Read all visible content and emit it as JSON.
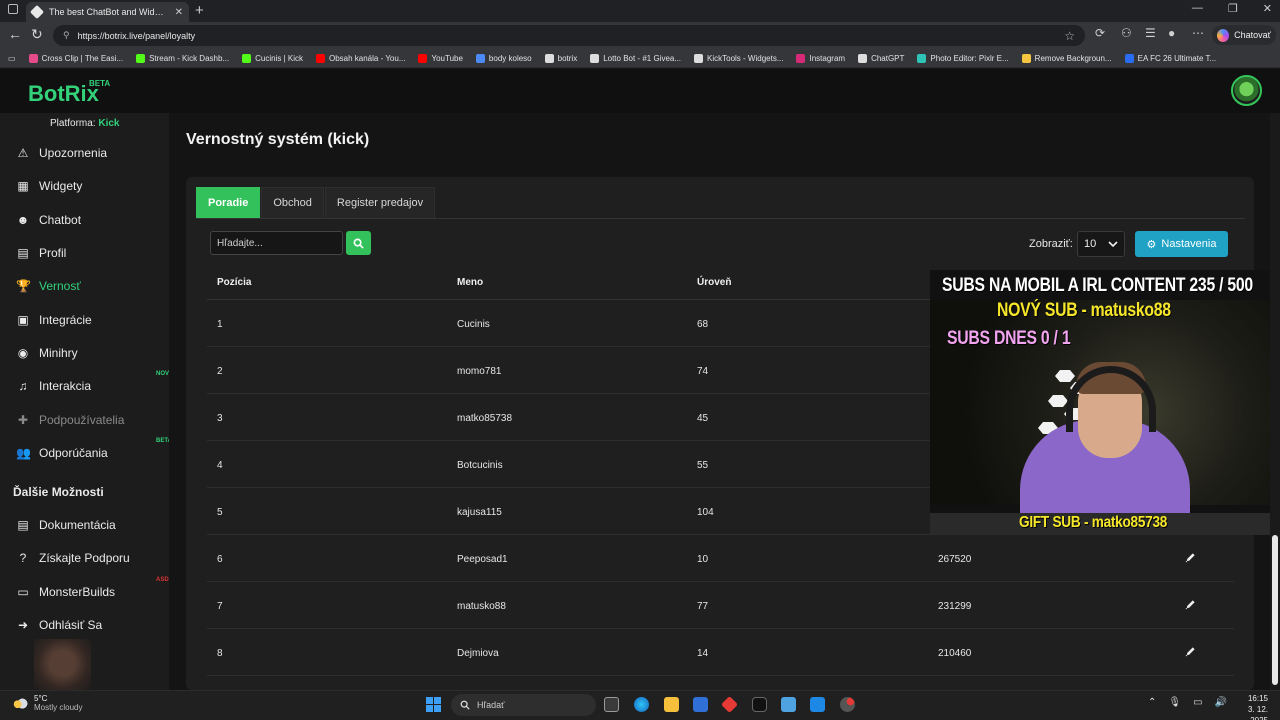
{
  "browser": {
    "tab_title": "The best ChatBot and Widgets for",
    "url": "https://botrix.live/panel/loyalty",
    "copilot_label": "Chatovať",
    "bookmarks": [
      {
        "label": "Cross Clip | The Easi...",
        "color": "#e54b8a"
      },
      {
        "label": "Stream - Kick Dashb...",
        "color": "#53fc18"
      },
      {
        "label": "Cucinis | Kick",
        "color": "#53fc18"
      },
      {
        "label": "Obsah kanála - You...",
        "color": "#ff0000"
      },
      {
        "label": "YouTube",
        "color": "#ff0000"
      },
      {
        "label": "body koleso",
        "color": "#4c8bf5"
      },
      {
        "label": "botrix",
        "color": "#dddddd"
      },
      {
        "label": "Lotto Bot - #1 Givea...",
        "color": "#dddddd"
      },
      {
        "label": "KickTools - Widgets...",
        "color": "#dddddd"
      },
      {
        "label": "Instagram",
        "color": "#d62976"
      },
      {
        "label": "ChatGPT",
        "color": "#dddddd"
      },
      {
        "label": "Photo Editor: Pixlr E...",
        "color": "#2ec4b6"
      },
      {
        "label": "Remove Backgroun...",
        "color": "#f5c542"
      },
      {
        "label": "EA FC 26 Ultimate T...",
        "color": "#2a6cf0"
      }
    ]
  },
  "header": {
    "logo": "BotRix",
    "beta": "BETA"
  },
  "sidebar": {
    "platform_label": "Platforma:",
    "platform_value": "Kick",
    "items": [
      {
        "label": "Upozornenia",
        "icon": "⚠"
      },
      {
        "label": "Widgety",
        "icon": "▦"
      },
      {
        "label": "Chatbot",
        "icon": "☻"
      },
      {
        "label": "Profil",
        "icon": "▤"
      },
      {
        "label": "Vernosť",
        "icon": "🏆"
      },
      {
        "label": "Integrácie",
        "icon": "▣"
      },
      {
        "label": "Minihry",
        "icon": "◉"
      },
      {
        "label": "Interakcia",
        "icon": "♫"
      },
      {
        "label": "Podpoužívatelia",
        "icon": "✚"
      },
      {
        "label": "Odporúčania",
        "icon": "👥"
      }
    ],
    "badge_new": "NOVÉ",
    "badge_beta": "BETA",
    "badge_asd": "ASD",
    "section_title": "Ďalšie Možnosti",
    "more_items": [
      {
        "label": "Dokumentácia",
        "icon": "▤"
      },
      {
        "label": "Získajte Podporu",
        "icon": "?"
      },
      {
        "label": "MonsterBuilds",
        "icon": "▭"
      },
      {
        "label": "Odhlásiť Sa",
        "icon": "➜"
      }
    ]
  },
  "main": {
    "title": "Vernostný systém (kick)",
    "tabs": [
      "Poradie",
      "Obchod",
      "Register predajov"
    ],
    "search_placeholder": "Hľadajte...",
    "show_label": "Zobraziť:",
    "show_value": "10",
    "settings_label": "Nastavenia",
    "table": {
      "headers": [
        "Pozícia",
        "Meno",
        "Úroveň"
      ],
      "rows": [
        {
          "pos": "1",
          "name": "Cucinis",
          "level": "68",
          "points": ""
        },
        {
          "pos": "2",
          "name": "momo781",
          "level": "74",
          "points": ""
        },
        {
          "pos": "3",
          "name": "matko85738",
          "level": "45",
          "points": ""
        },
        {
          "pos": "4",
          "name": "Botcucinis",
          "level": "55",
          "points": ""
        },
        {
          "pos": "5",
          "name": "kajusa115",
          "level": "104",
          "points": ""
        },
        {
          "pos": "6",
          "name": "Peeposad1",
          "level": "10",
          "points": "267520"
        },
        {
          "pos": "7",
          "name": "matusko88",
          "level": "77",
          "points": "231299"
        },
        {
          "pos": "8",
          "name": "Dejmiova",
          "level": "14",
          "points": "210460"
        }
      ]
    }
  },
  "overlay": {
    "line1": "SUBS NA MOBIL A IRL CONTENT  235 / 500",
    "line2": "NOVÝ SUB - matusko88",
    "line3": "SUBS DNES  0 / 1",
    "line4": "GIFT SUB - matko85738"
  },
  "taskbar": {
    "temp": "5°C",
    "weather": "Mostly cloudy",
    "search": "Hľadať",
    "time": "16:15",
    "date": "3. 12. 2025"
  }
}
